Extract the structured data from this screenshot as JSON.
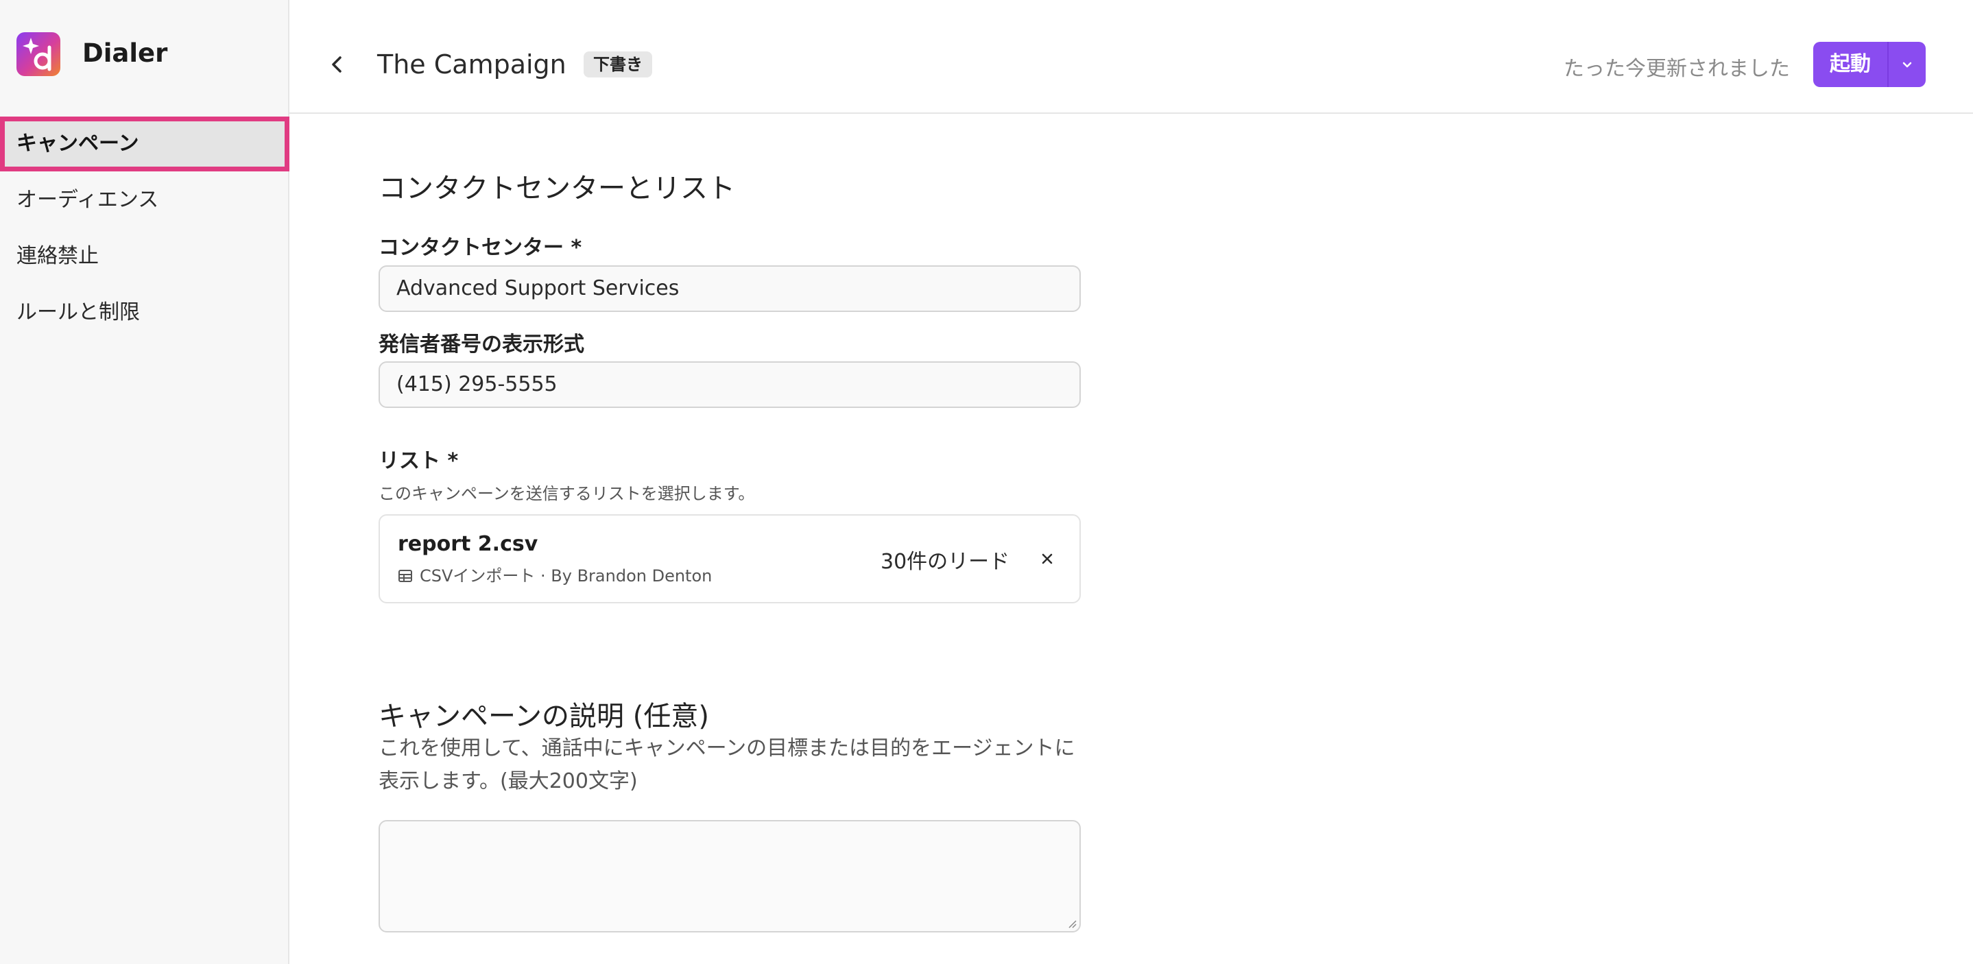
{
  "app": {
    "name": "Dialer",
    "logo_icon": "sparkle-d-logo-icon"
  },
  "sidebar": {
    "items": [
      {
        "label": "キャンペーン",
        "active": true
      },
      {
        "label": "オーディエンス",
        "active": false
      },
      {
        "label": "連絡禁止",
        "active": false
      },
      {
        "label": "ルールと制限",
        "active": false
      }
    ]
  },
  "header": {
    "title": "The Campaign",
    "badge": "下書き",
    "status": "たった今更新されました",
    "launch_label": "起動"
  },
  "contact_section": {
    "title": "コンタクトセンターとリスト",
    "contact_center_label": "コンタクトセンター *",
    "contact_center_value": "Advanced Support Services",
    "caller_id_label": "発信者番号の表示形式",
    "caller_id_value": "(415) 295-5555",
    "list_label": "リスト *",
    "list_help": "このキャンペーンを送信するリストを選択します。",
    "list_item": {
      "file_name": "report 2.csv",
      "meta": "CSVインポート · By Brandon Denton",
      "lead_count": "30件のリード"
    }
  },
  "description_section": {
    "title": "キャンペーンの説明 (任意)",
    "help": "これを使用して、通話中にキャンペーンの目標または目的をエージェントに表示します。(最大200文字)",
    "value": ""
  },
  "colors": {
    "accent": "#8a4cf0",
    "highlight": "#e03b82"
  }
}
